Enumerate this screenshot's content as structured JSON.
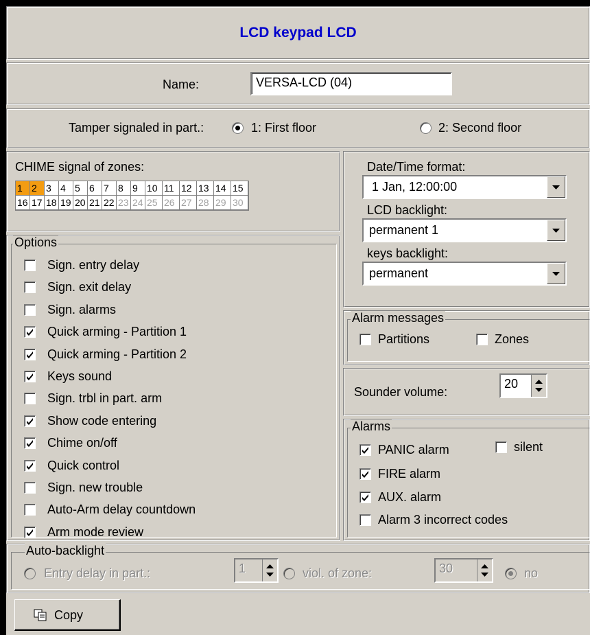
{
  "window": {
    "title": "LCD keypad LCD"
  },
  "name_row": {
    "label": "Name:",
    "value": "VERSA-LCD  (04)"
  },
  "tamper": {
    "label": "Tamper signaled in part.:",
    "option1": "1: First floor",
    "option2": "2: Second floor",
    "selected": 1
  },
  "chime": {
    "label": "CHIME signal of zones:",
    "row1": [
      "1",
      "2",
      "3",
      "4",
      "5",
      "6",
      "7",
      "8",
      "9",
      "10",
      "11",
      "12",
      "13",
      "14",
      "15"
    ],
    "row2": [
      "16",
      "17",
      "18",
      "19",
      "20",
      "21",
      "22",
      "23",
      "24",
      "25",
      "26",
      "27",
      "28",
      "29",
      "30"
    ],
    "active": [
      "1",
      "2"
    ],
    "disabled": [
      "23",
      "24",
      "25",
      "26",
      "27",
      "28",
      "29",
      "30"
    ]
  },
  "options": {
    "legend": "Options",
    "items": [
      {
        "label": "Sign. entry delay",
        "checked": false
      },
      {
        "label": "Sign. exit delay",
        "checked": false
      },
      {
        "label": "Sign. alarms",
        "checked": false
      },
      {
        "label": "Quick arming - Partition 1",
        "checked": true
      },
      {
        "label": "Quick arming - Partition 2",
        "checked": true
      },
      {
        "label": "Keys sound",
        "checked": true
      },
      {
        "label": "Sign. trbl in part. arm",
        "checked": false
      },
      {
        "label": "Show code entering",
        "checked": true
      },
      {
        "label": "Chime on/off",
        "checked": true
      },
      {
        "label": "Quick control",
        "checked": true
      },
      {
        "label": "Sign. new trouble",
        "checked": false
      },
      {
        "label": "Auto-Arm delay countdown",
        "checked": false
      },
      {
        "label": "Arm mode review",
        "checked": true
      }
    ]
  },
  "right": {
    "datetime_label": "Date/Time format:",
    "datetime_value": "1 Jan, 12:00:00",
    "lcd_backlight_label": "LCD backlight:",
    "lcd_backlight_value": "permanent 1",
    "keys_backlight_label": "keys backlight:",
    "keys_backlight_value": "permanent"
  },
  "alarm_messages": {
    "legend": "Alarm messages",
    "partitions": "Partitions",
    "zones": "Zones"
  },
  "sounder": {
    "label": "Sounder volume:",
    "value": "20"
  },
  "alarms": {
    "legend": "Alarms",
    "panic": "PANIC alarm",
    "silent": "silent",
    "fire": "FIRE alarm",
    "aux": "AUX. alarm",
    "incorrect": "Alarm 3 incorrect codes"
  },
  "auto_backlight": {
    "legend": "Auto-backlight",
    "entry_label": "Entry delay in part.:",
    "entry_value": "1",
    "zone_label": "viol. of zone:",
    "zone_value": "30",
    "no_label": "no"
  },
  "copy_button": {
    "label": "Copy"
  }
}
